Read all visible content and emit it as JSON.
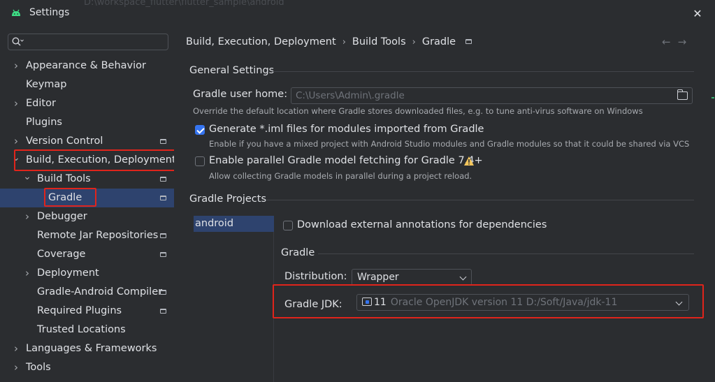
{
  "window": {
    "title": "Settings",
    "background_path": "D:\\workspace_flutter\\flutter_sample\\android"
  },
  "search": {
    "placeholder": ""
  },
  "sidebar": {
    "items": [
      {
        "label": "Appearance & Behavior",
        "expandable": true,
        "expanded": false,
        "pinned": false
      },
      {
        "label": "Keymap",
        "expandable": false,
        "pinned": false
      },
      {
        "label": "Editor",
        "expandable": true,
        "expanded": false,
        "pinned": false
      },
      {
        "label": "Plugins",
        "expandable": false,
        "pinned": false
      },
      {
        "label": "Version Control",
        "expandable": true,
        "expanded": false,
        "pinned": true
      },
      {
        "label": "Build, Execution, Deployment",
        "expandable": true,
        "expanded": true,
        "pinned": false
      },
      {
        "label": "Build Tools",
        "expandable": true,
        "expanded": true,
        "pinned": true
      },
      {
        "label": "Gradle",
        "expandable": false,
        "pinned": true,
        "selected": true
      },
      {
        "label": "Debugger",
        "expandable": true,
        "expanded": false,
        "pinned": false
      },
      {
        "label": "Remote Jar Repositories",
        "expandable": false,
        "pinned": true
      },
      {
        "label": "Coverage",
        "expandable": false,
        "pinned": true
      },
      {
        "label": "Deployment",
        "expandable": true,
        "expanded": false,
        "pinned": false
      },
      {
        "label": "Gradle-Android Compiler",
        "expandable": false,
        "pinned": true
      },
      {
        "label": "Required Plugins",
        "expandable": false,
        "pinned": true
      },
      {
        "label": "Trusted Locations",
        "expandable": false,
        "pinned": false
      },
      {
        "label": "Languages & Frameworks",
        "expandable": true,
        "expanded": false,
        "pinned": false
      },
      {
        "label": "Tools",
        "expandable": true,
        "expanded": false,
        "pinned": false
      }
    ]
  },
  "breadcrumb": {
    "items": [
      "Build, Execution, Deployment",
      "Build Tools",
      "Gradle"
    ],
    "separator": "›"
  },
  "general_settings": {
    "title": "General Settings",
    "user_home_label": "Gradle user home:",
    "user_home_value": "C:\\Users\\Admin\\.gradle",
    "user_home_hint": "Override the default location where Gradle stores downloaded files, e.g. to tune anti-virus software on Windows",
    "iml": {
      "label": "Generate *.iml files for modules imported from Gradle",
      "hint": "Enable if you have a mixed project with Android Studio modules and Gradle modules so that it could be shared via VCS",
      "checked": true
    },
    "parallel": {
      "label": "Enable parallel Gradle model fetching for Gradle 7.4+",
      "hint": "Allow collecting Gradle models in parallel during a project reload.",
      "checked": false
    }
  },
  "gradle_projects": {
    "title": "Gradle Projects",
    "projects": [
      "android"
    ],
    "download_annotations": {
      "label": "Download external annotations for dependencies",
      "checked": false
    },
    "gradle_section_title": "Gradle",
    "distribution_label": "Distribution:",
    "distribution_value": "Wrapper",
    "jdk_label": "Gradle JDK:",
    "jdk_version": "11",
    "jdk_desc": "Oracle OpenJDK version 11 D:/Soft/Java/jdk-11"
  },
  "colors": {
    "background": "#2b2d30",
    "selection": "#2e436e",
    "accent": "#3574f0",
    "highlight_box": "#e0241b",
    "warning": "#f2c55c",
    "android_green": "#3ddc84"
  },
  "icons": [
    "android-icon",
    "search-icon",
    "close-icon",
    "folder-icon",
    "warning-icon",
    "jdk-icon",
    "pin-icon",
    "chevron-right-icon",
    "chevron-down-icon",
    "back-arrow-icon",
    "forward-arrow-icon"
  ]
}
